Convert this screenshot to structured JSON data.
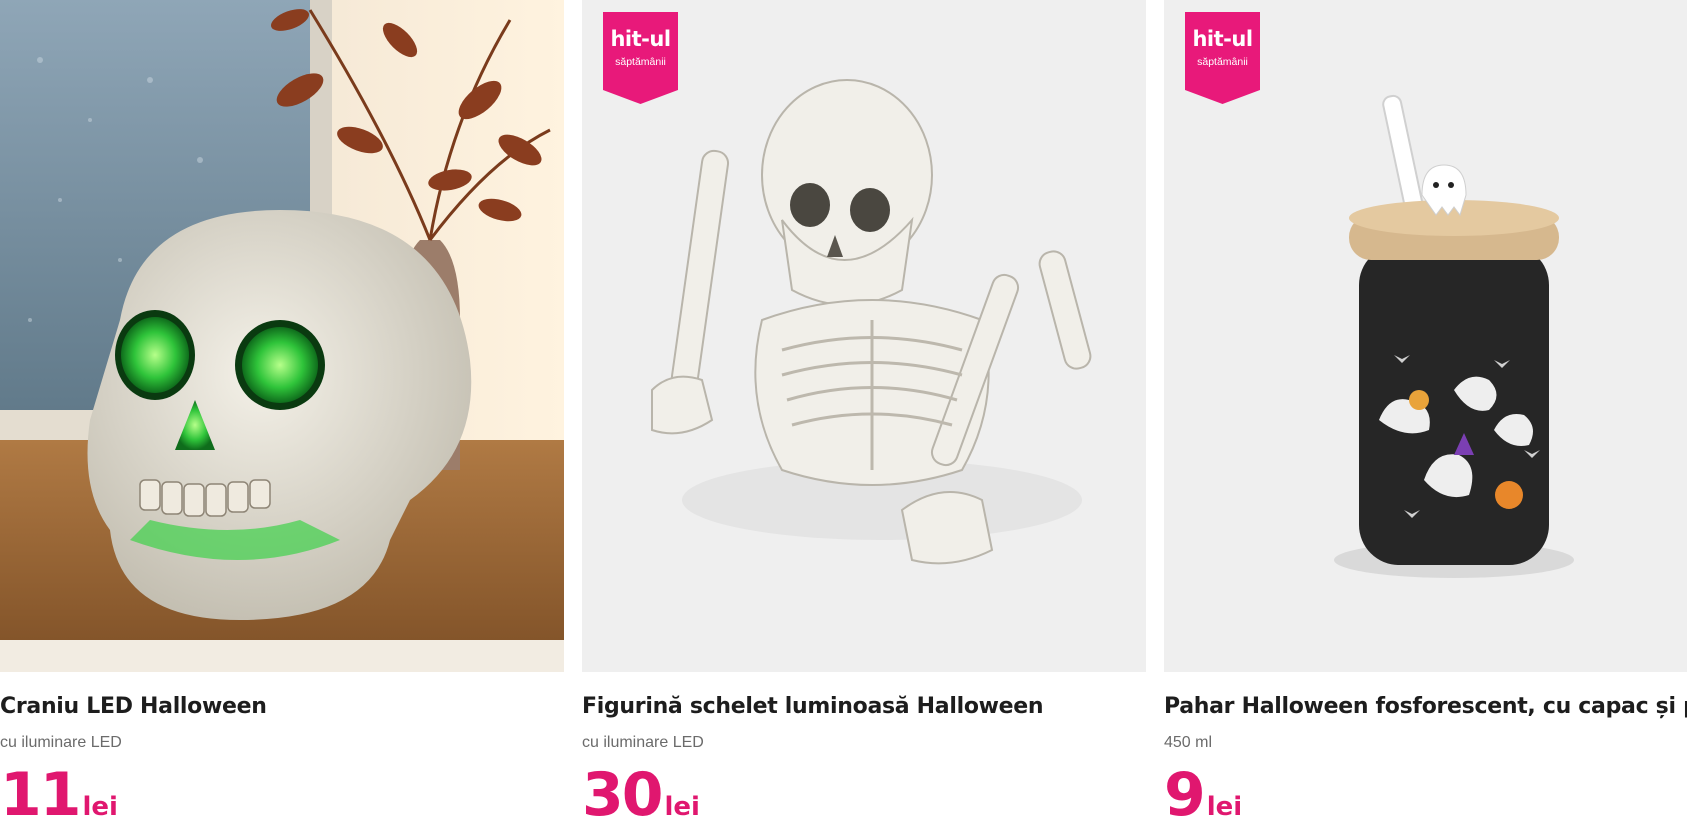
{
  "colors": {
    "accent": "#e0176f",
    "badge": "#e8197a",
    "background": "#ffffff"
  },
  "badge": {
    "line1": "hit-ul",
    "line2": "săptămânii"
  },
  "products": [
    {
      "title": "Craniu LED Halloween",
      "subtitle": "cu iluminare LED",
      "price": "11",
      "currency": "lei",
      "has_badge": false,
      "image": "skull-image"
    },
    {
      "title": "Figurină schelet luminoasă Halloween",
      "subtitle": "cu iluminare LED",
      "price": "30",
      "currency": "lei",
      "has_badge": true,
      "image": "skeleton-image"
    },
    {
      "title": "Pahar Halloween fosforescent, cu capac și pai",
      "subtitle": "450 ml",
      "price": "9",
      "currency": "lei",
      "has_badge": true,
      "image": "ghost-cup-image"
    }
  ]
}
